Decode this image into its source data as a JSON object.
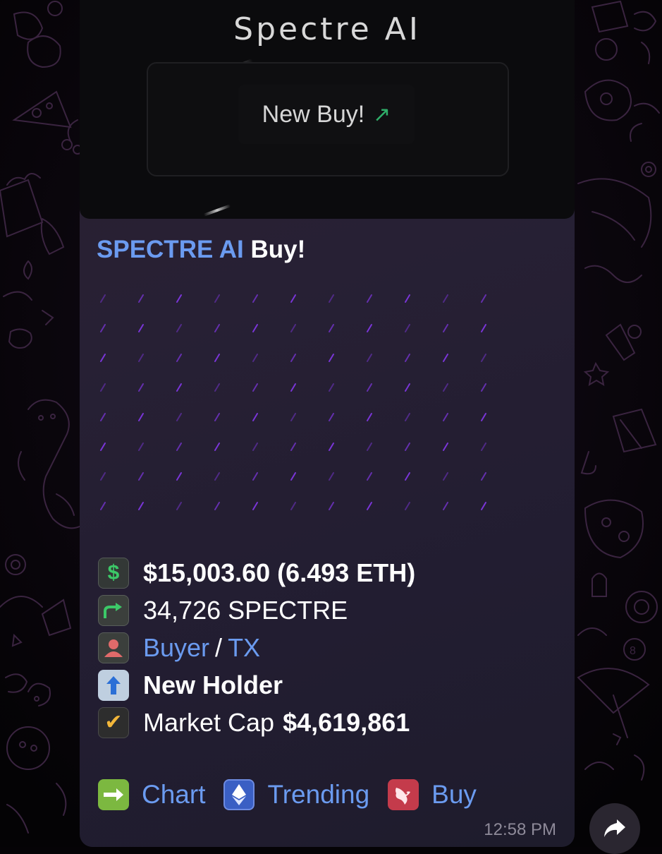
{
  "media": {
    "title": "Spectre AI",
    "button_label": "New Buy!",
    "button_icon": "arrow-up-right-icon"
  },
  "message": {
    "headline_link": "SPECTRE AI",
    "headline_rest": "Buy!",
    "stats": {
      "amount": "$15,003.60 (6.493 ETH)",
      "tokens": "34,726 SPECTRE",
      "buyer_label": "Buyer",
      "separator": "/",
      "tx_label": "TX",
      "holder_status": "New Holder",
      "market_cap_label": "Market Cap",
      "market_cap_value": "$4,619,861"
    },
    "buttons": {
      "chart": "Chart",
      "trending": "Trending",
      "buy": "Buy"
    },
    "timestamp": "12:58 PM"
  },
  "icons": {
    "amount": "dollar-icon",
    "tokens": "share-arrow-icon",
    "buyer": "person-icon",
    "holder": "up-arrow-icon",
    "market_cap": "check-icon",
    "chart": "right-arrow-icon",
    "trending": "ethereum-icon",
    "buy": "uniswap-icon",
    "forward": "forward-icon"
  },
  "colors": {
    "link": "#6b9bf0",
    "bubble": "#272034",
    "pattern": "#7a35d8",
    "accent_green": "#3cc968"
  }
}
